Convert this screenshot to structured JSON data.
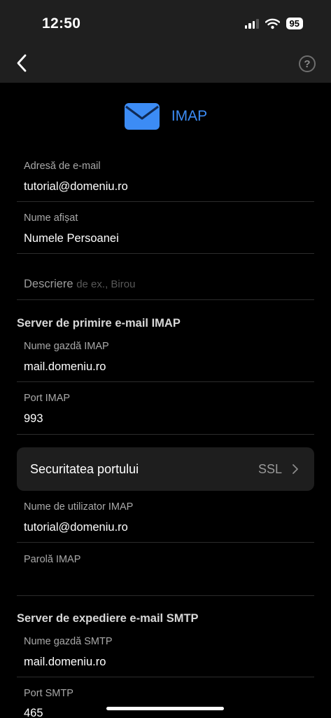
{
  "status": {
    "time": "12:50",
    "battery": "95",
    "icons": [
      "signal-icon",
      "wifi-icon",
      "battery-icon"
    ]
  },
  "nav": {
    "back_icon": "chevron-left-icon",
    "help_icon": "question-circle-icon",
    "help_glyph": "?"
  },
  "header": {
    "icon": "mail-envelope-icon",
    "title": "IMAP"
  },
  "fields": {
    "email": {
      "label": "Adresă de e-mail",
      "value": "tutorial@domeniu.ro"
    },
    "display_name": {
      "label": "Nume afișat",
      "value": "Numele Persoanei"
    },
    "description": {
      "label": "Descriere",
      "placeholder": "de ex., Birou"
    }
  },
  "incoming": {
    "section_title": "Server de primire e-mail IMAP",
    "host": {
      "label": "Nume gazdă IMAP",
      "value": "mail.domeniu.ro"
    },
    "port": {
      "label": "Port IMAP",
      "value": "993"
    },
    "security": {
      "label": "Securitatea portului",
      "value": "SSL"
    },
    "username": {
      "label": "Nume de utilizator IMAP",
      "value": "tutorial@domeniu.ro"
    },
    "password": {
      "label": "Parolă IMAP",
      "value": ""
    }
  },
  "outgoing": {
    "section_title": "Server de expediere e-mail SMTP",
    "host": {
      "label": "Nume gazdă SMTP",
      "value": "mail.domeniu.ro"
    },
    "port": {
      "label": "Port SMTP",
      "value": "465"
    }
  },
  "colors": {
    "accent": "#3c8cf5",
    "background": "#000000",
    "bar": "#1f1f1f",
    "row": "#1e1e1e"
  }
}
